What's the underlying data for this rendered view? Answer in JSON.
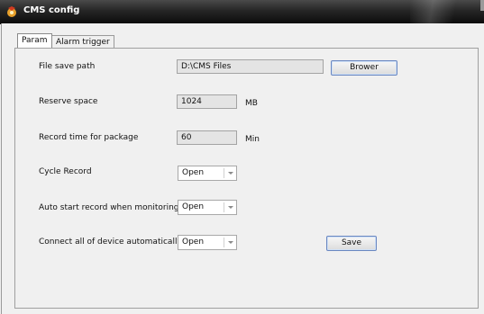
{
  "window": {
    "title": "CMS config"
  },
  "tabs": [
    {
      "label": "Param",
      "active": true
    },
    {
      "label": "Alarm trigger",
      "active": false
    }
  ],
  "fields": {
    "file_save_path": {
      "label": "File save path",
      "value": "D:\\CMS Files",
      "button": "Brower"
    },
    "reserve_space": {
      "label": "Reserve space",
      "value": "1024",
      "unit": "MB"
    },
    "record_time": {
      "label": "Record time for package",
      "value": "60",
      "unit": "Min"
    },
    "cycle_record": {
      "label": "Cycle Record",
      "value": "Open"
    },
    "auto_start": {
      "label": "Auto start record when monitoring",
      "value": "Open"
    },
    "connect_all": {
      "label": "Connect all of device automatically",
      "value": "Open"
    }
  },
  "actions": {
    "save_label": "Save"
  },
  "colors": {
    "titlebar": "#1a1a1a",
    "panel_bg": "#f0f0f0",
    "button_border": "#6a87c0"
  },
  "icons": [
    "app-icon",
    "chevron-down-icon"
  ]
}
